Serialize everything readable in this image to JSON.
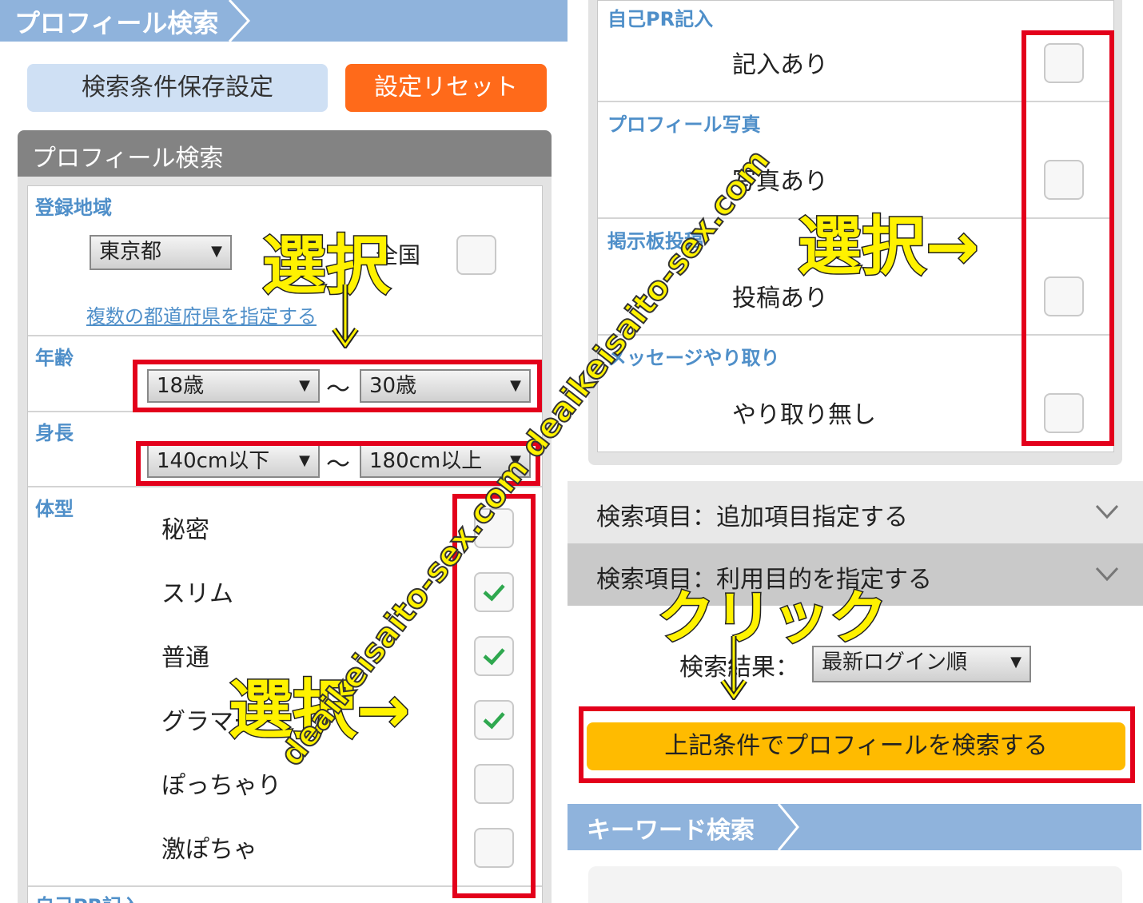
{
  "left": {
    "header_title": "プロフィール検索",
    "save_button": "検索条件保存設定",
    "reset_button": "設定リセット",
    "panel_title": "プロフィール検索",
    "region": {
      "label": "登録地域",
      "selected": "東京都",
      "nationwide_label": "全国",
      "multi_link": "複数の都道府県を指定する"
    },
    "age": {
      "label": "年齢",
      "from": "18歳",
      "to": "30歳",
      "tilde": "〜"
    },
    "height": {
      "label": "身長",
      "from": "140cm以下",
      "to": "180cm以上",
      "tilde": "〜"
    },
    "body_type": {
      "label": "体型",
      "options": [
        {
          "label": "秘密",
          "checked": false
        },
        {
          "label": "スリム",
          "checked": true
        },
        {
          "label": "普通",
          "checked": true
        },
        {
          "label": "グラマー",
          "checked": true
        },
        {
          "label": "ぽっちゃり",
          "checked": false
        },
        {
          "label": "激ぽちゃ",
          "checked": false
        }
      ]
    },
    "next_section_label": "自己PR記入"
  },
  "right": {
    "sections": [
      {
        "label": "自己PR記入",
        "option": "記入あり",
        "checked": false
      },
      {
        "label": "プロフィール写真",
        "option": "写真あり",
        "checked": false
      },
      {
        "label": "掲示板投稿",
        "option": "投稿あり",
        "checked": false
      },
      {
        "label": "メッセージやり取り",
        "option": "やり取り無し",
        "checked": false
      }
    ],
    "accordion_1": "検索項目：追加項目指定する",
    "accordion_2": "検索項目：利用目的を指定する",
    "sort_label": "検索結果：",
    "sort_selected": "最新ログイン順",
    "search_button": "上記条件でプロフィールを検索する",
    "keyword_header": "キーワード検索"
  },
  "annotations": {
    "select_1": "選択",
    "select_2": "選択→",
    "select_3": "選択→",
    "click": "クリック",
    "watermark": "deaikeisaito-sex.com deaikeisaito-sex.com"
  },
  "colors": {
    "accent_blue": "#8fb3dc",
    "reset_orange": "#ff6a1a",
    "search_yellow": "#ffbb00",
    "annotation_red": "#e3001b",
    "annotation_yellow": "#fff200",
    "check_green": "#2fa84f"
  },
  "icons": {
    "dropdown": "dropdown-arrow-icon",
    "check": "check-icon",
    "chevron": "chevron-down-icon"
  }
}
